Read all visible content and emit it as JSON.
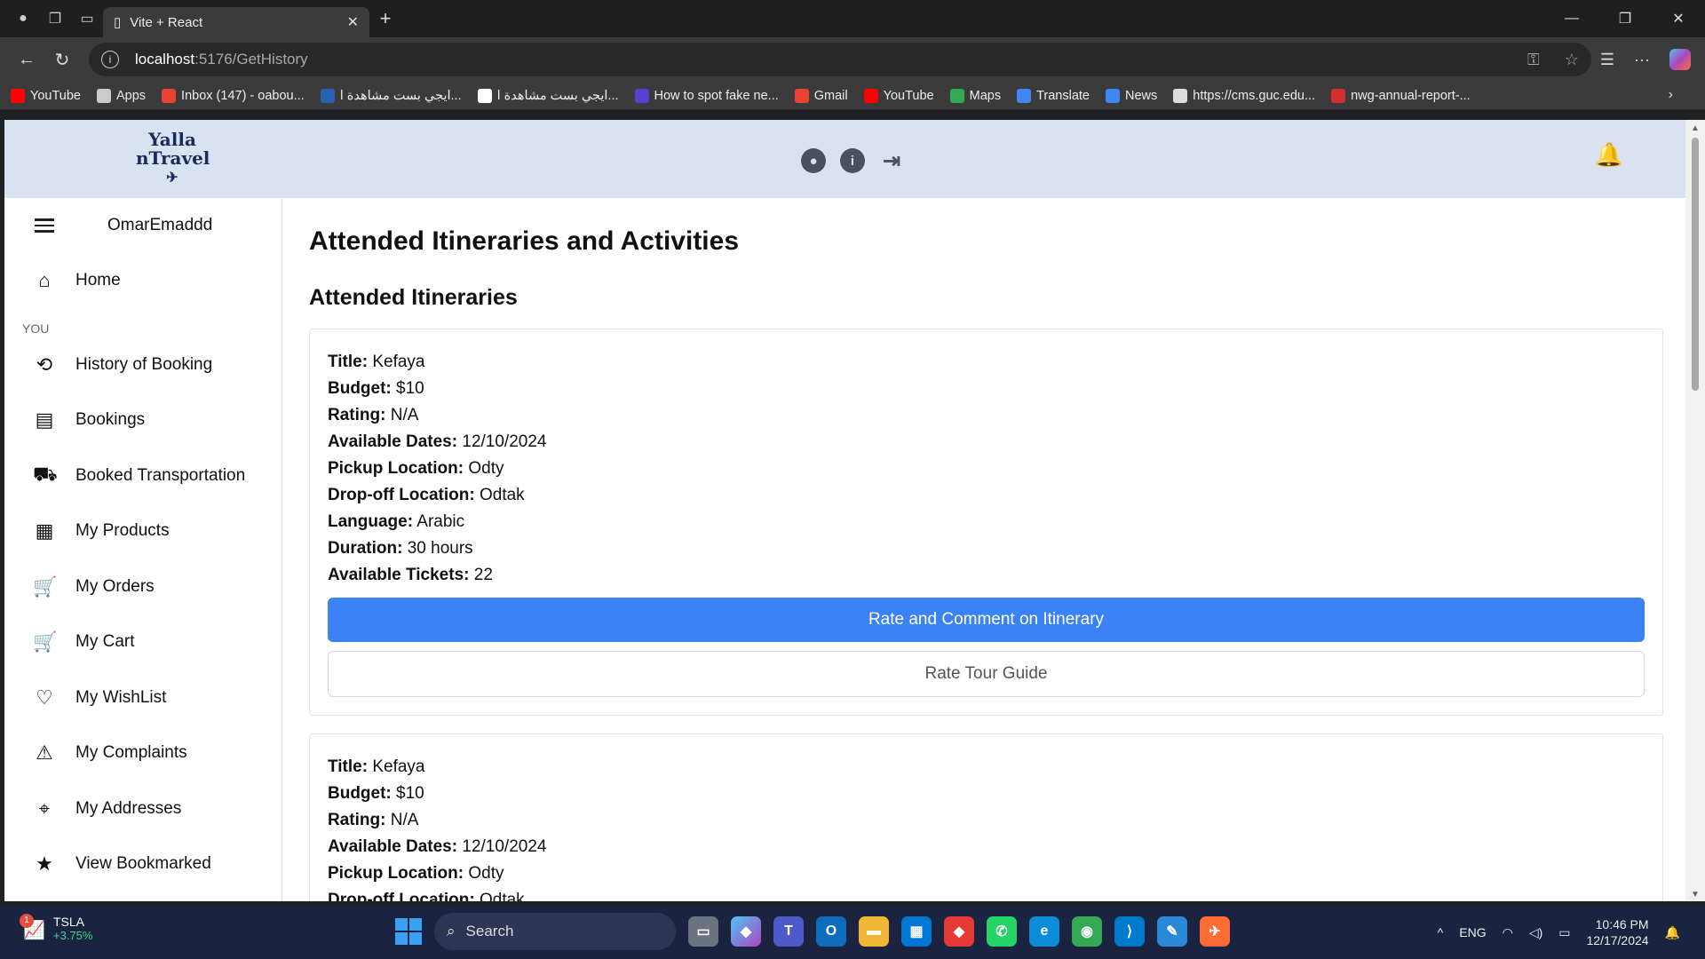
{
  "browser": {
    "tab_title": "Vite + React",
    "url_host": "localhost",
    "url_path": ":5176/GetHistory",
    "bookmarks": [
      {
        "label": "YouTube",
        "color": "#ff0000"
      },
      {
        "label": "Apps",
        "color": "#cccccc"
      },
      {
        "label": "Inbox (147) - oabou...",
        "color": "#ea4335"
      },
      {
        "label": "ايجي بست مشاهدة ا...",
        "color": "#2b5fb3"
      },
      {
        "label": "ايجي بست مشاهدة ا...",
        "color": "#ffffff"
      },
      {
        "label": "How to spot fake ne...",
        "color": "#5b3fd1"
      },
      {
        "label": "Gmail",
        "color": "#ea4335"
      },
      {
        "label": "YouTube",
        "color": "#ff0000"
      },
      {
        "label": "Maps",
        "color": "#34a853"
      },
      {
        "label": "Translate",
        "color": "#4285f4"
      },
      {
        "label": "News",
        "color": "#4285f4"
      },
      {
        "label": "https://cms.guc.edu...",
        "color": "#dddddd"
      },
      {
        "label": "nwg-annual-report-...",
        "color": "#d32f2f"
      }
    ]
  },
  "app": {
    "logo_line1": "Yalla",
    "logo_line2": "nTravel",
    "bell_icon": "bell-icon",
    "sidebar": {
      "username": "OmarEmaddd",
      "home_label": "Home",
      "section_label": "YOU",
      "items": [
        {
          "label": "History of Booking",
          "icon": "⟲"
        },
        {
          "label": "Bookings",
          "icon": "▤"
        },
        {
          "label": "Booked Transportation",
          "icon": "⛟"
        },
        {
          "label": "My Products",
          "icon": "▦"
        },
        {
          "label": "My Orders",
          "icon": "🛒"
        },
        {
          "label": "My Cart",
          "icon": "🛒"
        },
        {
          "label": "My WishList",
          "icon": "♡"
        },
        {
          "label": "My Complaints",
          "icon": "⚠"
        },
        {
          "label": "My Addresses",
          "icon": "⌖"
        },
        {
          "label": "View Bookmarked",
          "icon": "★"
        }
      ]
    },
    "main": {
      "page_title": "Attended Itineraries and Activities",
      "section_title": "Attended Itineraries",
      "field_labels": {
        "title": "Title:",
        "budget": "Budget:",
        "rating": "Rating:",
        "dates": "Available Dates:",
        "pickup": "Pickup Location:",
        "dropoff": "Drop-off Location:",
        "language": "Language:",
        "duration": "Duration:",
        "tickets": "Available Tickets:"
      },
      "cards": [
        {
          "title": "Kefaya",
          "budget": "$10",
          "rating": "N/A",
          "dates": "12/10/2024",
          "pickup": "Odty",
          "dropoff": "Odtak",
          "language": "Arabic",
          "duration": "30 hours",
          "tickets": "22",
          "rate_itinerary_label": "Rate and Comment on Itinerary",
          "rate_guide_label": "Rate Tour Guide"
        },
        {
          "title": "Kefaya",
          "budget": "$10",
          "rating": "N/A",
          "dates": "12/10/2024",
          "pickup": "Odty",
          "dropoff": "Odtak"
        }
      ]
    }
  },
  "taskbar": {
    "stock_badge": "1",
    "stock_name": "TSLA",
    "stock_change": "+3.75%",
    "search_label": "Search",
    "lang": "ENG",
    "time": "10:46 PM",
    "date": "12/17/2024"
  }
}
